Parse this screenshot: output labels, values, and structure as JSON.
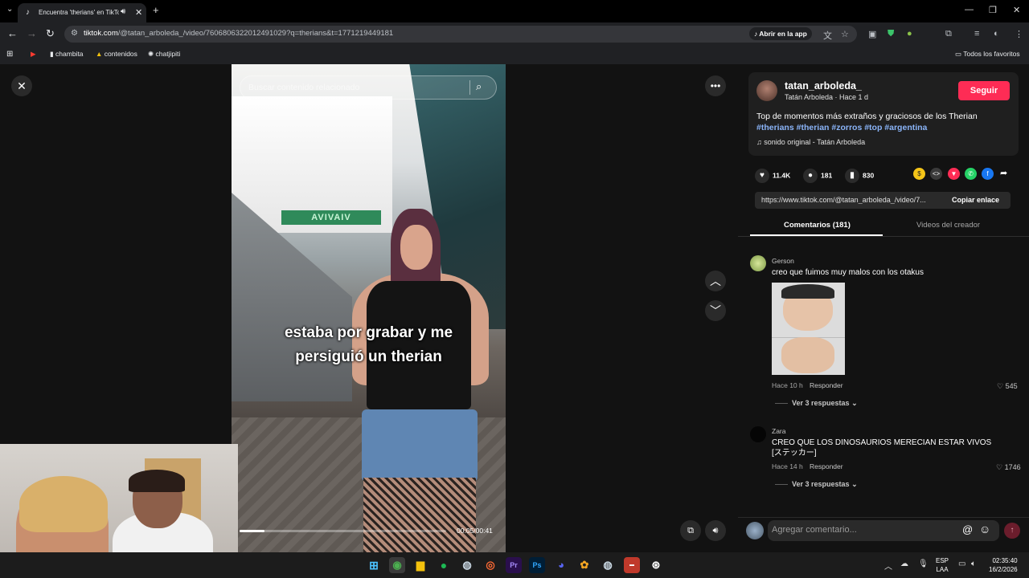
{
  "browser": {
    "tab_title": "Encuentra 'therians' en TikTok",
    "url_host": "tiktok.com",
    "url_path": "/@tatan_arboleda_/video/7606806322012491029?q=therians&t=1771219449181",
    "open_in_app": "Abrir en la app",
    "bookmarks": [
      "chambita",
      "contenidos",
      "chatjipiti"
    ],
    "all_bookmarks": "Todos los favoritos"
  },
  "video": {
    "search_placeholder": "Buscar contenido relacionado",
    "caption_line1": "estaba por grabar y me",
    "caption_line2": "persiguió un therian",
    "sign_text": "AVIVAIV",
    "time": "00:05/00:41",
    "progress_fraction": 0.12
  },
  "post": {
    "username": "tatan_arboleda_",
    "subtitle": "Tatán Arboleda · Hace 1 d",
    "follow_label": "Seguir",
    "description": "Top de momentos más extraños y graciosos de los Therian",
    "hashtags": "#therians #therian #zorros #top #argentina",
    "sound": "sonido original - Tatán Arboleda",
    "likes": "11.4K",
    "comments": "181",
    "saves": "830",
    "link": "https://www.tiktok.com/@tatan_arboleda_/video/7...",
    "copy_link": "Copiar enlace"
  },
  "tabs": {
    "comments": "Comentarios (181)",
    "creator_videos": "Videos del creador"
  },
  "comments": [
    {
      "user": "Gerson",
      "text": "creo que fuimos muy malos con los otakus",
      "time": "Hace 10 h",
      "reply": "Responder",
      "likes": "545",
      "view_replies": "Ver 3 respuestas"
    },
    {
      "user": "Zara",
      "text": "CREO QUE LOS DINOSAURIOS MERECIAN ESTAR VIVOS",
      "text2": "[ステッカー]",
      "time": "Hace 14 h",
      "reply": "Responder",
      "likes": "1746",
      "view_replies": "Ver 3 respuestas"
    }
  ],
  "comment_placeholder": "Agregar comentario...",
  "taskbar": {
    "lang1": "ESP",
    "lang2": "LAA",
    "time": "02:35:40",
    "date": "16/2/2026"
  },
  "colors": {
    "accent": "#fe2c55",
    "hashtag": "#8ab4f8",
    "panel_bg": "#121212"
  }
}
